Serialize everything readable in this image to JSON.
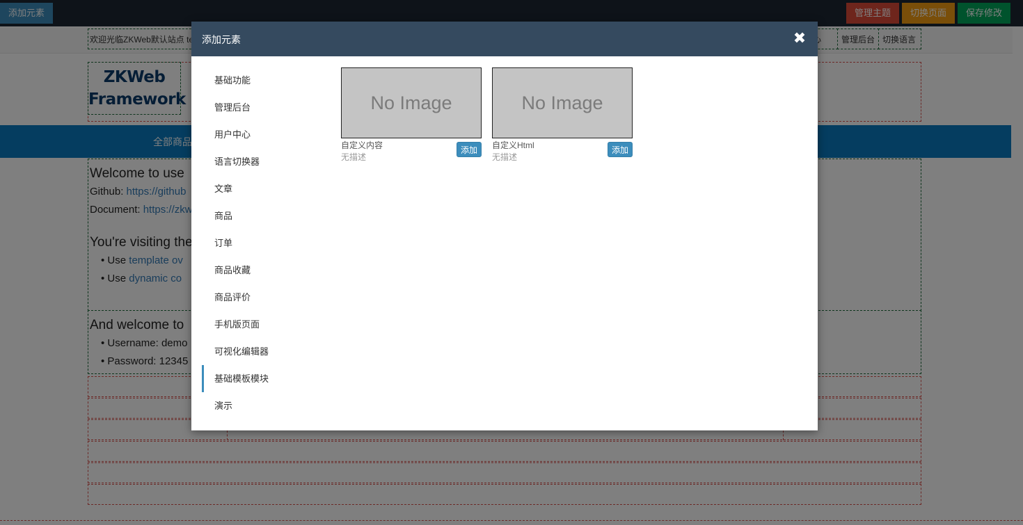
{
  "toolbar": {
    "add_element": "添加元素",
    "manage_theme": "管理主题",
    "switch_page": "切换页面",
    "save_changes": "保存修改"
  },
  "site": {
    "welcome": "欢迎光临ZKWeb默认站点 te",
    "header_links": [
      "中心",
      "管理后台",
      "切换语言"
    ],
    "logo": "ZKWeb\nFramework",
    "nav_item": "全部商品",
    "content": {
      "heading1": "Welcome to use",
      "github_label": "Github:",
      "github_link": "https://github",
      "document_label": "Document:",
      "document_link": "https://zkw",
      "heading2": "You're visiting the",
      "bullet1_prefix": "Use",
      "bullet1_link": "template ov",
      "bullet2_prefix": "Use",
      "bullet2_link": "dynamic co",
      "heading3": "And welcome to",
      "bullet3": "Username: demo",
      "bullet4": "Password: 12345"
    }
  },
  "modal": {
    "title": "添加元素",
    "close_icon": "close-icon",
    "categories": [
      {
        "label": "基础功能",
        "active": false
      },
      {
        "label": "管理后台",
        "active": false
      },
      {
        "label": "用户中心",
        "active": false
      },
      {
        "label": "语言切换器",
        "active": false
      },
      {
        "label": "文章",
        "active": false
      },
      {
        "label": "商品",
        "active": false
      },
      {
        "label": "订单",
        "active": false
      },
      {
        "label": "商品收藏",
        "active": false
      },
      {
        "label": "商品评价",
        "active": false
      },
      {
        "label": "手机版页面",
        "active": false
      },
      {
        "label": "可视化编辑器",
        "active": false
      },
      {
        "label": "基础模板模块",
        "active": true
      },
      {
        "label": "演示",
        "active": false
      }
    ],
    "elements": [
      {
        "image_text": "No Image",
        "name": "自定义内容",
        "description": "无描述",
        "button": "添加"
      },
      {
        "image_text": "No Image",
        "name": "自定义Html",
        "description": "无描述",
        "button": "添加"
      }
    ]
  },
  "colors": {
    "modal_header": "#354a5f",
    "accent": "#3c8dbc",
    "danger": "#dd4b39",
    "warning": "#f39c12",
    "success": "#00a65a",
    "nav_blue": "#0a7bc1"
  }
}
